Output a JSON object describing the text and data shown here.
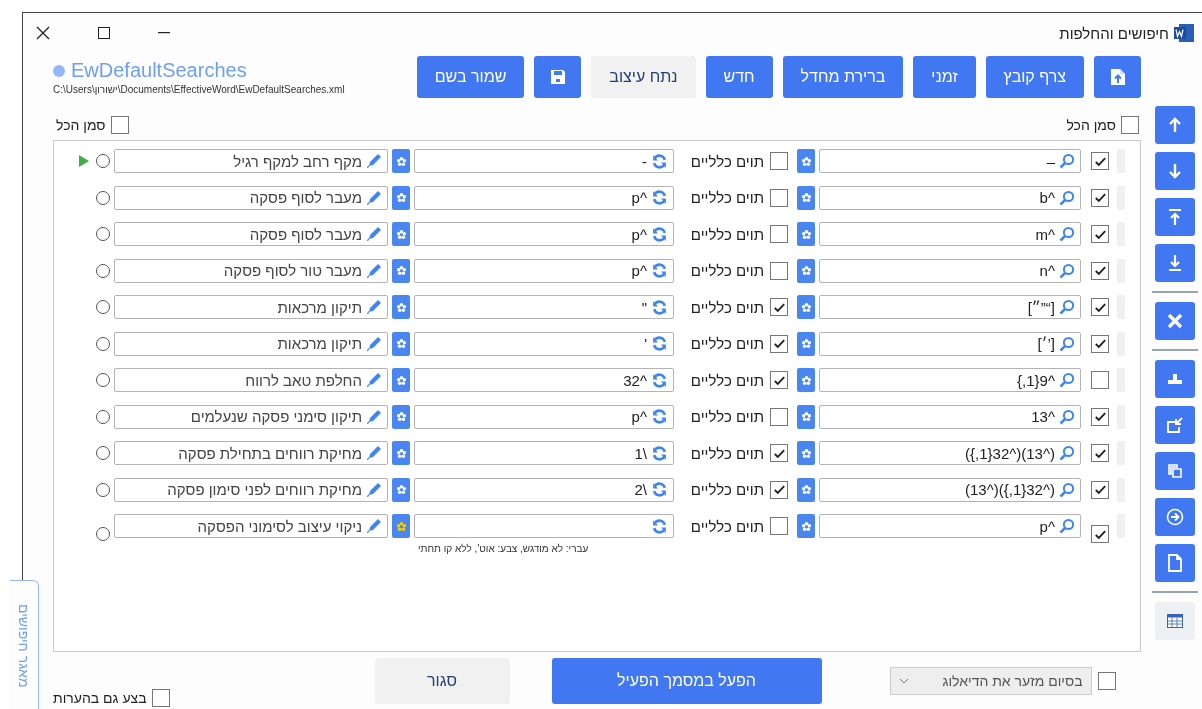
{
  "window": {
    "title": "חיפושים והחלפות"
  },
  "file": {
    "name": "EwDefaultSearches",
    "path": "C:\\Users\\ישורון\\Documents\\EffectiveWord\\EwDefaultSearches.xml"
  },
  "buttons": [
    {
      "label": "צרף קובץ",
      "kind": "primary"
    },
    {
      "label": "זמני",
      "kind": "primary"
    },
    {
      "label": "ברירת מחדל",
      "kind": "primary"
    },
    {
      "label": "חדש",
      "kind": "primary"
    },
    {
      "label": "נתח עיצוב",
      "kind": "secondary"
    },
    {
      "label": "שמור בשם",
      "kind": "primary"
    }
  ],
  "select_all_find": {
    "label": "סמן הכל",
    "checked": false
  },
  "select_all_desc": {
    "label": "סמן הכל",
    "checked": false
  },
  "rows": [
    {
      "enabled": true,
      "find": "–",
      "find_format": false,
      "wildcards_label": "תוים כלליים",
      "wildcards": false,
      "replace": "-",
      "replace_format": false,
      "description": "מקף רחב למקף רגיל",
      "selected": false,
      "current": true
    },
    {
      "enabled": true,
      "find": "^b",
      "find_format": false,
      "wildcards_label": "תוים כלליים",
      "wildcards": false,
      "replace": "^p",
      "replace_format": false,
      "description": "מעבר לסוף פסקה",
      "selected": false,
      "current": false
    },
    {
      "enabled": true,
      "find": "^m",
      "find_format": false,
      "wildcards_label": "תוים כלליים",
      "wildcards": false,
      "replace": "^p",
      "replace_format": false,
      "description": "מעבר לסוף פסקה",
      "selected": false,
      "current": false
    },
    {
      "enabled": true,
      "find": "^n",
      "find_format": false,
      "wildcards_label": "תוים כלליים",
      "wildcards": false,
      "replace": "^p",
      "replace_format": false,
      "description": "מעבר טור לסוף פסקה",
      "selected": false,
      "current": false
    },
    {
      "enabled": true,
      "find": "[“”״]",
      "find_format": false,
      "wildcards_label": "תוים כלליים",
      "wildcards": true,
      "replace": "\"",
      "replace_format": false,
      "description": "תיקון מרכאות",
      "selected": false,
      "current": false
    },
    {
      "enabled": true,
      "find": "[’׳]",
      "find_format": false,
      "wildcards_label": "תוים כלליים",
      "wildcards": true,
      "replace": "'",
      "replace_format": false,
      "description": "תיקון מרכאות",
      "selected": false,
      "current": false
    },
    {
      "enabled": false,
      "find": "^9{1,}",
      "find_format": false,
      "wildcards_label": "תוים כלליים",
      "wildcards": true,
      "replace": "^32",
      "replace_format": false,
      "description": "החלפת טאב לרווח",
      "selected": false,
      "current": false
    },
    {
      "enabled": true,
      "find": "^13",
      "find_format": false,
      "wildcards_label": "תוים כלליים",
      "wildcards": false,
      "replace": "^p",
      "replace_format": false,
      "description": "תיקון סימני פסקה שנעלמים",
      "selected": false,
      "current": false
    },
    {
      "enabled": true,
      "find": "(^13)(^32{1,})",
      "find_format": false,
      "wildcards_label": "תוים כלליים",
      "wildcards": true,
      "replace": "\\1",
      "replace_format": false,
      "description": "מחיקת רווחים בתחילת פסקה",
      "selected": false,
      "current": false
    },
    {
      "enabled": true,
      "find": "(^32{1,})(^13)",
      "find_format": false,
      "wildcards_label": "תוים כלליים",
      "wildcards": true,
      "replace": "\\2",
      "replace_format": false,
      "description": "מחיקת רווחים לפני סימון פסקה",
      "selected": false,
      "current": false
    },
    {
      "enabled": true,
      "find": "^p",
      "find_format": false,
      "wildcards_label": "תוים כלליים",
      "wildcards": false,
      "replace_format": true,
      "note": "עברי: לא מודגש, צבע: אוט', ללא קו תחתי",
      "description": "ניקוי עיצוב לסימוני הפסקה",
      "selected": false,
      "current": false
    }
  ],
  "side_tab": {
    "label": "מאגר חיפושים"
  },
  "comments": {
    "label": "בצע גם בהערות",
    "checked": false
  },
  "close": {
    "label": "סגור"
  },
  "run": {
    "label": "הפעל במסמך הפעיל"
  },
  "minimize": {
    "label": "בסיום מזער את הדיאלוג",
    "checked": false,
    "disabled": true
  }
}
